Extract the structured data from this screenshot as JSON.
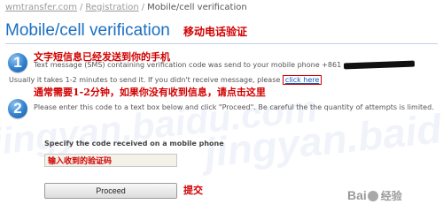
{
  "breadcrumb": {
    "site": "wmtransfer.com",
    "separator": "/",
    "registration": "Registration",
    "current": "Mobile/cell verification"
  },
  "page": {
    "title": "Mobile/cell verification",
    "title_cn": "移动电话验证"
  },
  "steps": {
    "one": {
      "number": "1",
      "annotation_cn": "文字短信息已经发送到你的手机",
      "text": "Text message (SMS) containing verification code was send to your mobile phone +861",
      "resend_text": "Usually it takes 1-2 minutes to send it. If you didn't receive message, please",
      "resend_link": "click here",
      "resend_annotation_cn": "通常需要1-2分钟，如果你没有收到信息，请点击这里"
    },
    "two": {
      "number": "2",
      "text": "Please enter this code to a text box below and click \"Proceed\". Be careful the the quantity of attempts is limited."
    }
  },
  "form": {
    "label": "Specify the code received on a mobile phone",
    "code_input_value": "输入收到的验证码",
    "proceed_label": "Proceed",
    "submit_annotation_cn": "提交"
  },
  "watermark": {
    "text_left": "jingyan.baidu.com",
    "text_right": "jingyan.baidu.com",
    "logo_text": "Bai",
    "logo_suffix": "经验"
  },
  "colors": {
    "title_blue": "#1a6fc1",
    "annotation_red": "#d00000",
    "link_blue": "#1a55b0"
  },
  "icons": {
    "step_badge": "numbered-circle-icon",
    "logo_paw": "paw-icon",
    "phone_redaction": "scribble-mask"
  }
}
